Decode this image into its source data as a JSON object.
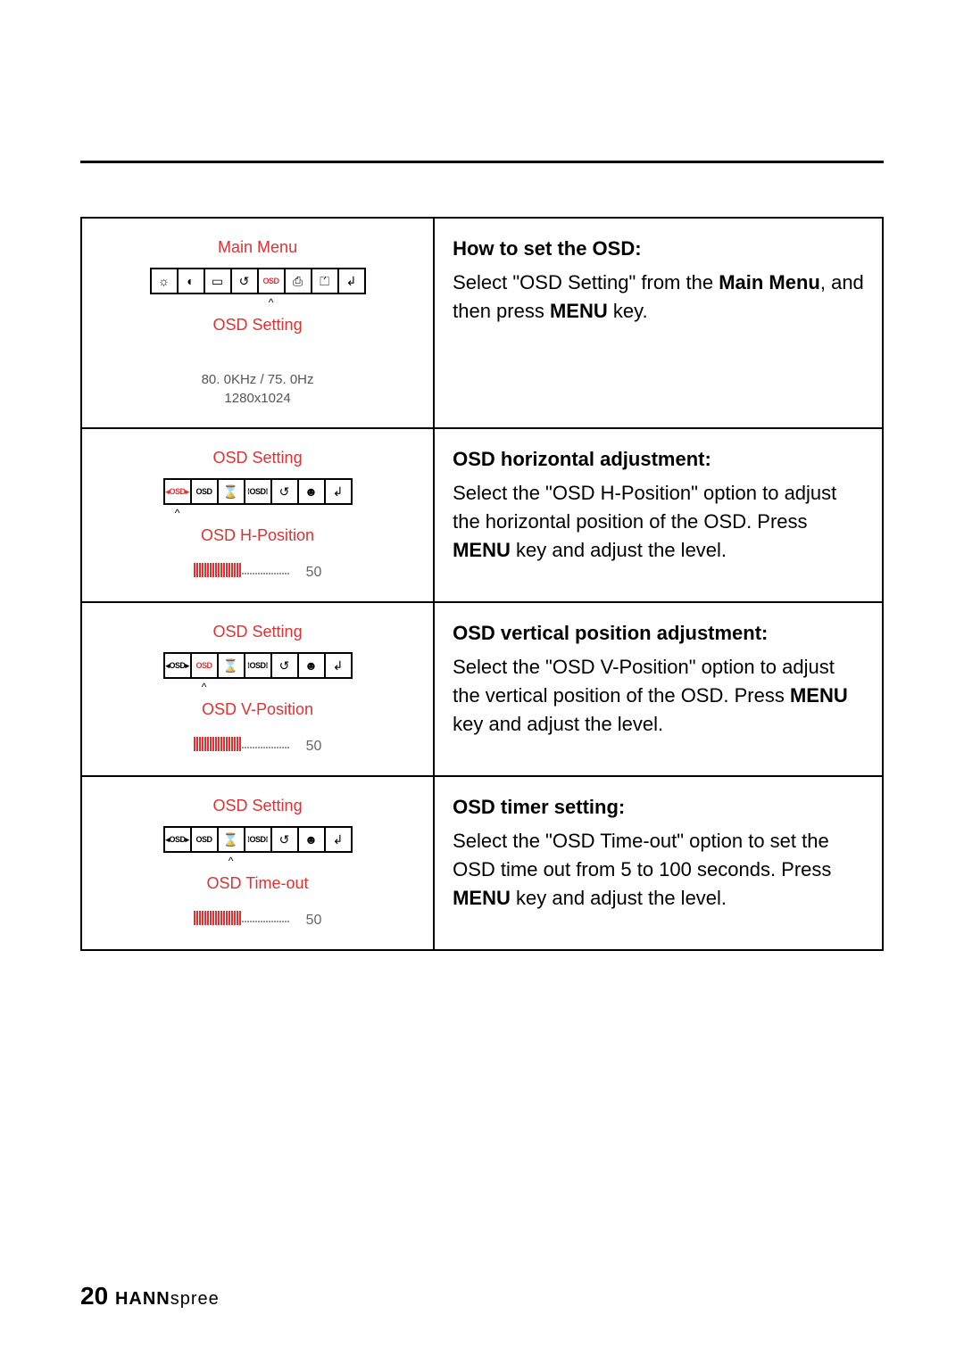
{
  "page_number": "20",
  "brand_bold": "HANN",
  "brand_light": "spree",
  "rows": [
    {
      "osd": {
        "title": "Main  Menu",
        "subtitle": "OSD Setting",
        "info_line1": "80. 0KHz / 75. 0Hz",
        "info_line2": "1280x1024",
        "type": "main"
      },
      "right": {
        "heading": "How to set the OSD:",
        "p1a": "Select \"OSD Setting\" from the ",
        "p1b": "Main Menu",
        "p1c": ", and then press ",
        "p1d": "MENU",
        "p1e": " key."
      }
    },
    {
      "osd": {
        "title": "OSD  Setting",
        "subtitle": "OSD H-Position",
        "value": "50",
        "type": "hpos"
      },
      "right": {
        "heading": "OSD horizontal adjustment:",
        "p1a": "Select the \"OSD H-Position\" option to adjust the horizontal position of the OSD. Press ",
        "p1b": "MENU",
        "p1c": " key and adjust the level."
      }
    },
    {
      "osd": {
        "title": "OSD  Setting",
        "subtitle": "OSD V-Position",
        "value": "50",
        "type": "vpos"
      },
      "right": {
        "heading": "OSD vertical position adjustment:",
        "p1a": "Select the \"OSD V-Position\" option to adjust the vertical position of the OSD. Press ",
        "p1b": "MENU",
        "p1c": " key and adjust the level."
      }
    },
    {
      "osd": {
        "title": "OSD  Setting",
        "subtitle": "OSD Time-out",
        "value": "50",
        "type": "timeout"
      },
      "right": {
        "heading": "OSD timer setting:",
        "p1a": "Select the \"OSD Time-out\" option to set the OSD time out from 5 to 100 seconds. Press ",
        "p1b": "MENU",
        "p1c": " key and adjust the level."
      }
    }
  ],
  "icons": {
    "main": [
      "☼",
      "◐",
      "▭",
      "↺",
      "OSD",
      "⎙",
      "⏍",
      "↲"
    ],
    "sub": [
      "◂OSD▸",
      "OSD",
      "⌛",
      "⁞OSD⁞",
      "↺",
      "☻",
      "↲"
    ]
  }
}
